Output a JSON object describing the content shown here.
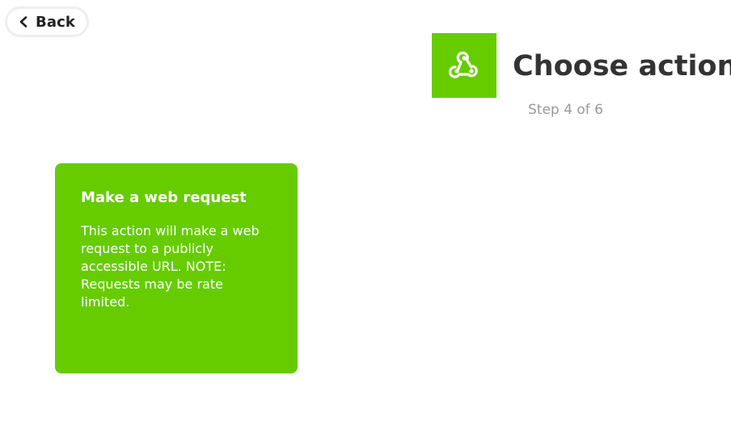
{
  "nav": {
    "back_label": "Back",
    "back_icon": "chevron-left-icon"
  },
  "header": {
    "service_icon": "webhooks-icon",
    "title": "Choose action",
    "step": "Step 4 of 6"
  },
  "actions": [
    {
      "title": "Make a web request",
      "description": "This action will make a web request to a publicly accessible URL. NOTE: Requests may be rate limited."
    }
  ],
  "colors": {
    "brand": "#66cc00",
    "title_text": "#333333",
    "muted_text": "#999999",
    "button_border": "#eeeeee"
  }
}
